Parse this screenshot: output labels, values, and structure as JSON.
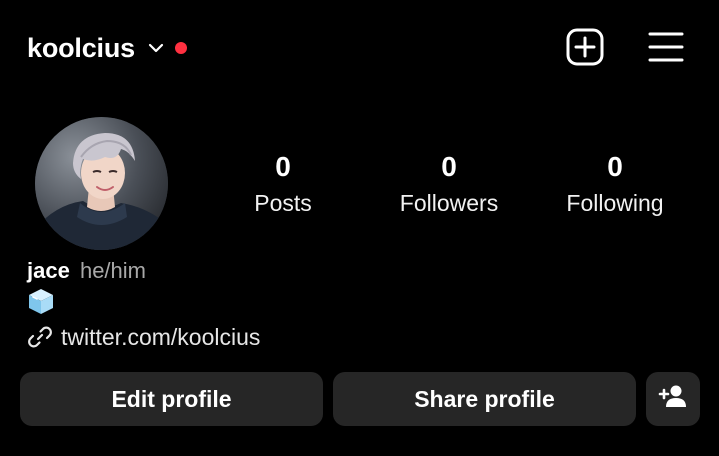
{
  "header": {
    "username": "koolcius",
    "icons": [
      "chevron-down-icon",
      "notification-dot",
      "add-post-icon",
      "menu-icon"
    ],
    "accent_color": "#ff3040"
  },
  "profile": {
    "avatar_icon": "avatar",
    "stats": [
      {
        "value": "0",
        "label": "Posts"
      },
      {
        "value": "0",
        "label": "Followers"
      },
      {
        "value": "0",
        "label": "Following"
      }
    ],
    "name": "jace",
    "pronouns": "he/him",
    "bio_emoji_icon": "ice-cube-icon",
    "link_icon": "link-icon",
    "link": "twitter.com/koolcius"
  },
  "actions": {
    "edit_profile": "Edit profile",
    "share_profile": "Share profile",
    "add_user_icon": "add-user-icon"
  },
  "colors": {
    "background": "#000000",
    "button_background": "#262626",
    "text": "#ffffff",
    "secondary_text": "#a8a8a8"
  }
}
